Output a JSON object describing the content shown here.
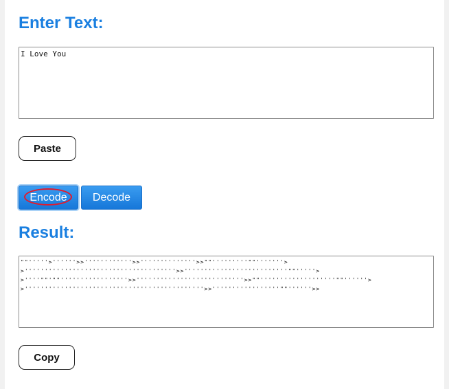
{
  "enter_text": {
    "heading": "Enter Text:",
    "input_value": "I Love You"
  },
  "paste_button": {
    "label": "Paste"
  },
  "encode_button": {
    "label": "Encode"
  },
  "decode_button": {
    "label": "Decode"
  },
  "result": {
    "heading": "Result:",
    "value": "\"\"'''''>''''''>>''''''''''''>>''''''''''''''>>\"\"'''''''''\"\"'''''''>>''''''''''''''''''''''''''''''''''''''>>''''''''''''''''''''''''''\"\"'''''>>''''\"\"'\"\"'''''''''''''''''>>'''''''''''''''''''''''''''>>\"\"'''''''''''''''''''\"\"''''''>>'''''''''''''''''''''''''''''''''''''''''''''>>'''''''''''''''''\"\"''''''>>"
  },
  "copy_button": {
    "label": "Copy"
  },
  "colors": {
    "heading": "#1a7fe0",
    "primary_button": "#1677d9",
    "annotation": "#e01b2e"
  }
}
